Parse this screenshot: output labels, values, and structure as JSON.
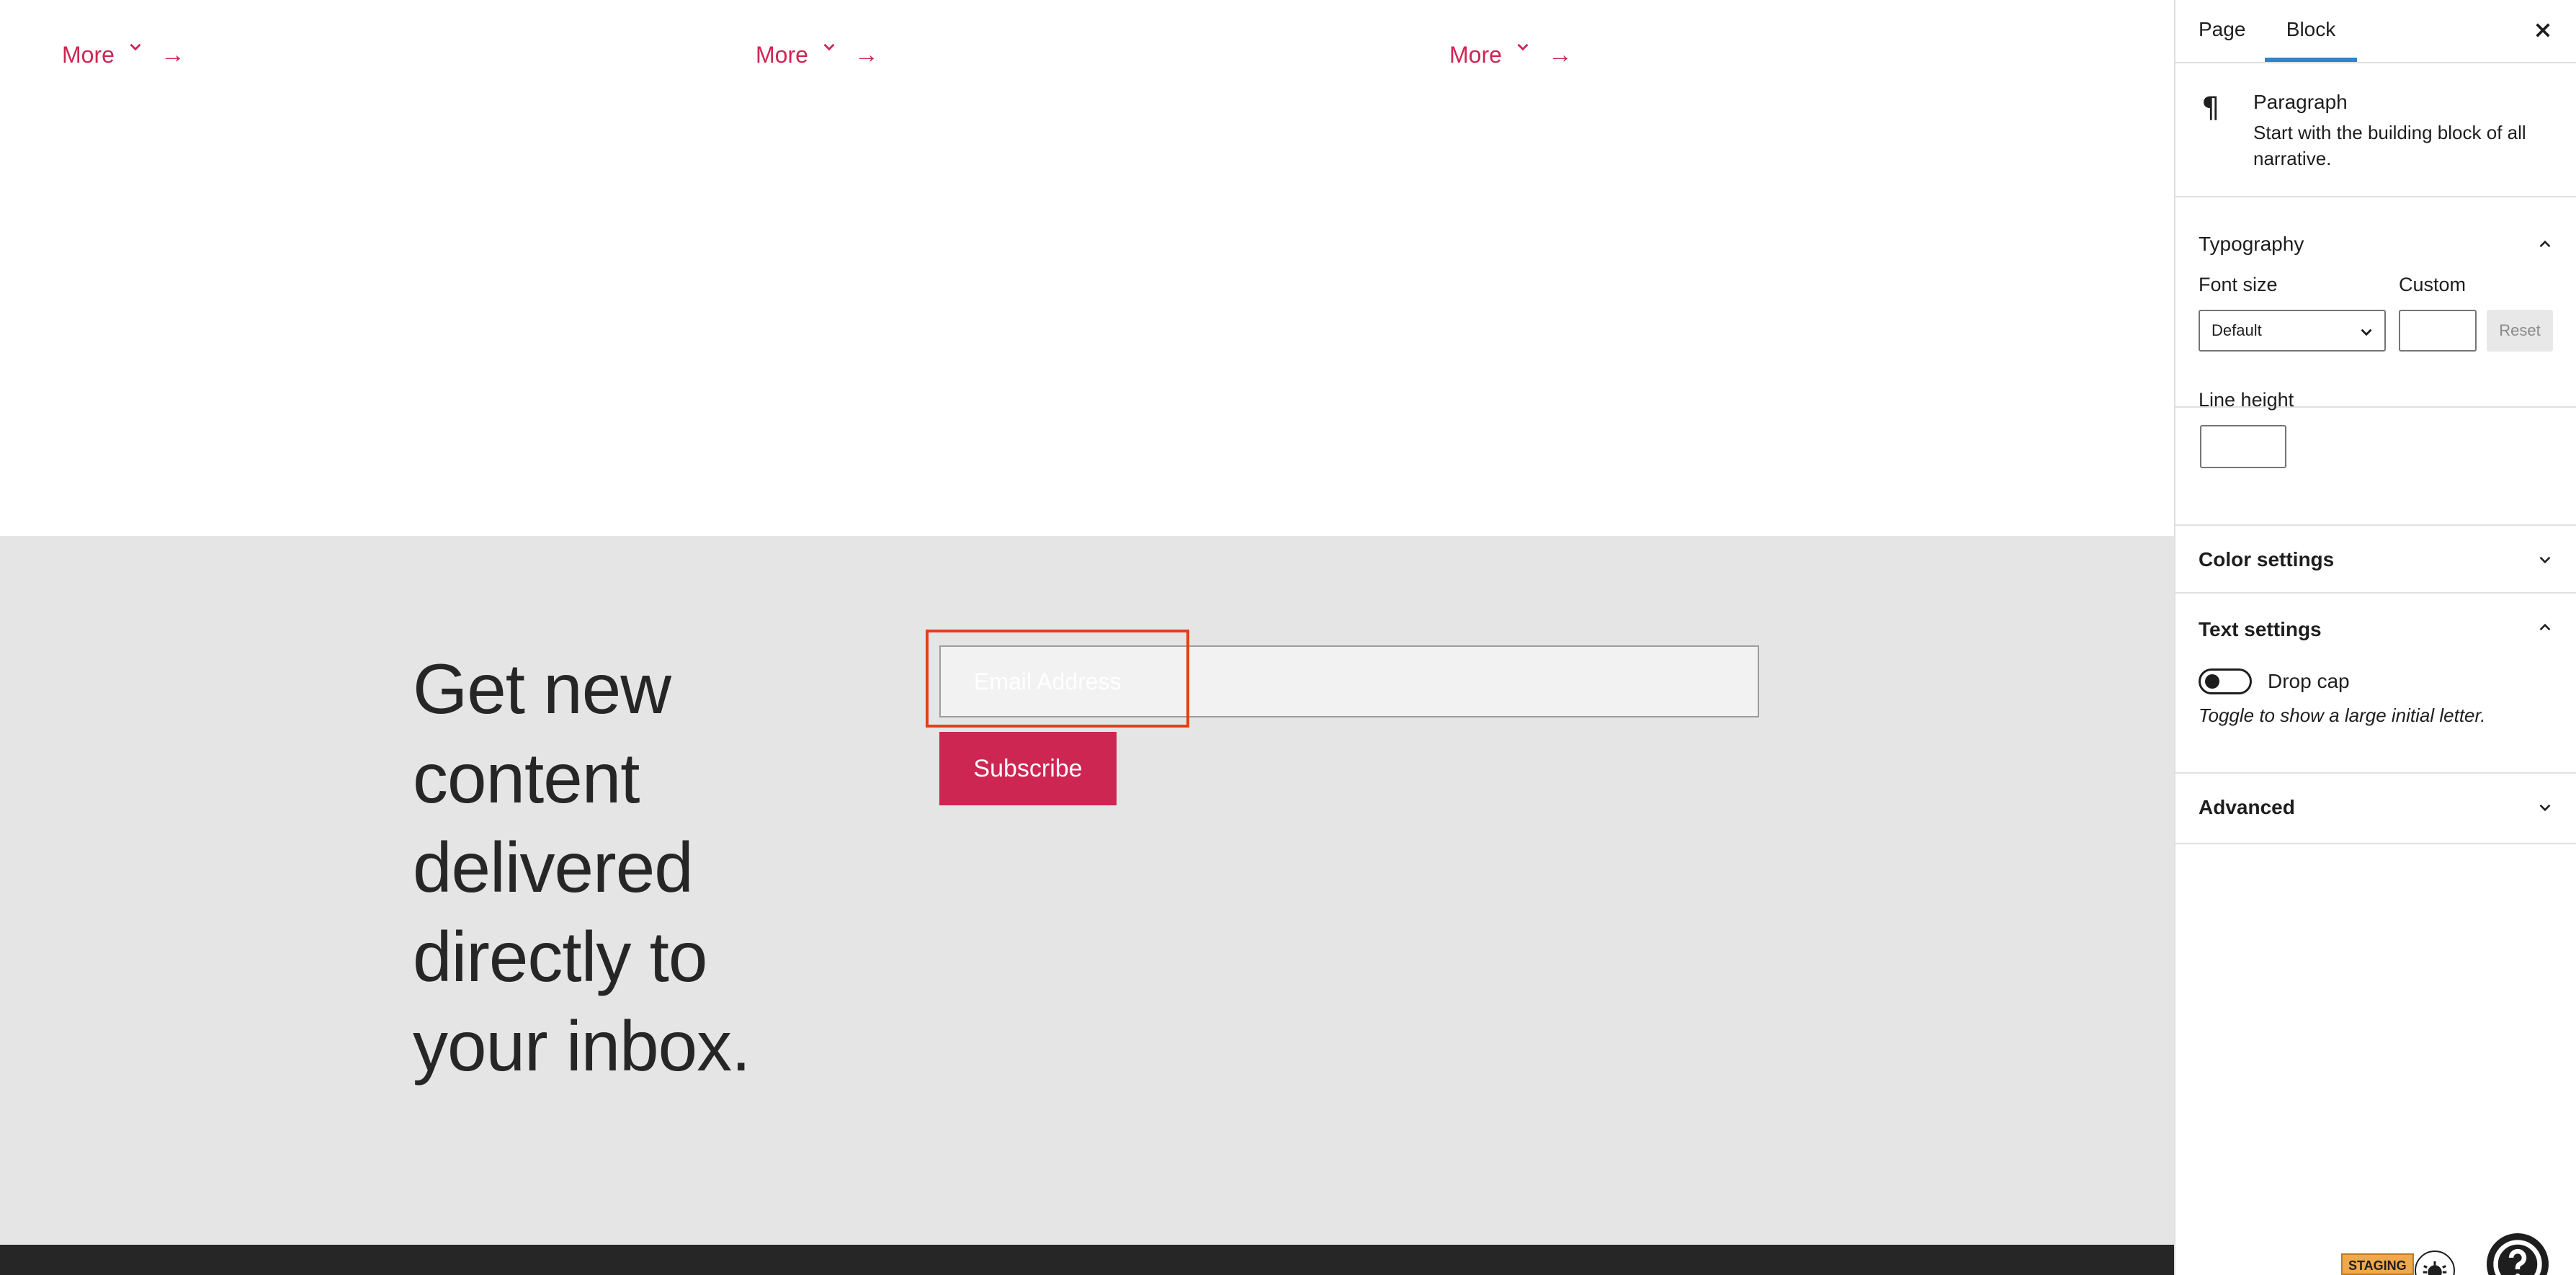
{
  "canvas": {
    "more_links": [
      {
        "label": "More",
        "arrow": "→"
      },
      {
        "label": "More",
        "arrow": "→"
      },
      {
        "label": "More",
        "arrow": "→"
      }
    ],
    "newsletter": {
      "heading": "Get new content delivered directly to your inbox.",
      "email_placeholder": "Email Address",
      "subscribe_label": "Subscribe"
    }
  },
  "sidebar": {
    "tabs": [
      {
        "label": "Page"
      },
      {
        "label": "Block"
      }
    ],
    "active_tab": "Block",
    "block_card": {
      "icon": "paragraph-icon",
      "icon_glyph": "¶",
      "title": "Paragraph",
      "description": "Start with the building block of all narrative."
    },
    "typography": {
      "title": "Typography",
      "font_size_label": "Font size",
      "font_size_value": "Default",
      "custom_label": "Custom",
      "reset_label": "Reset",
      "line_height_label": "Line height"
    },
    "color_settings": {
      "title": "Color settings"
    },
    "text_settings": {
      "title": "Text settings",
      "drop_cap_label": "Drop cap",
      "drop_cap_help": "Toggle to show a large initial letter.",
      "drop_cap_enabled": false
    },
    "advanced": {
      "title": "Advanced"
    }
  },
  "footer": {
    "staging_badge": "STAGING"
  },
  "colors": {
    "accent": "#cd2653",
    "tab_active": "#3582c4",
    "highlight": "#e2401c",
    "newsletter_bg": "#e5e5e5",
    "footer_bg": "#262626"
  }
}
